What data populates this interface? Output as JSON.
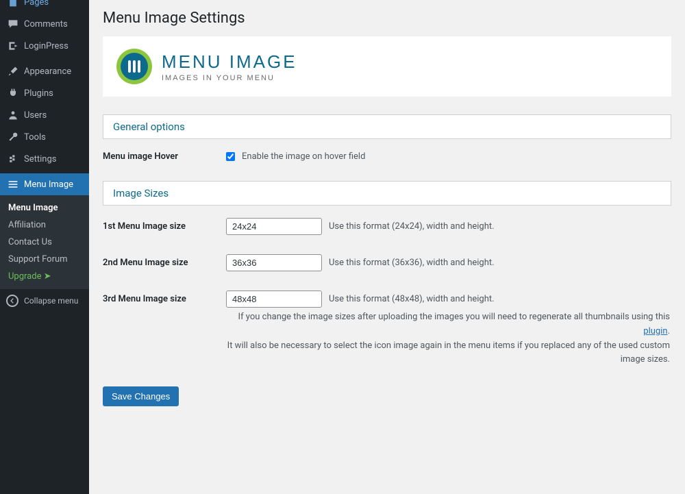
{
  "sidebar": {
    "items": [
      {
        "id": "pages",
        "label": "Pages",
        "icon": "page-icon"
      },
      {
        "id": "comments",
        "label": "Comments",
        "icon": "comment-icon"
      },
      {
        "id": "loginpress",
        "label": "LoginPress",
        "icon": "loginpress-icon"
      },
      {
        "id": "appearance",
        "label": "Appearance",
        "icon": "brush-icon"
      },
      {
        "id": "plugins",
        "label": "Plugins",
        "icon": "plug-icon"
      },
      {
        "id": "users",
        "label": "Users",
        "icon": "user-icon"
      },
      {
        "id": "tools",
        "label": "Tools",
        "icon": "wrench-icon"
      },
      {
        "id": "settings",
        "label": "Settings",
        "icon": "settings-icon"
      },
      {
        "id": "menu-image",
        "label": "Menu Image",
        "icon": "menu-icon",
        "current": true
      }
    ],
    "submenu": [
      {
        "label": "Menu Image",
        "current": true
      },
      {
        "label": "Affiliation"
      },
      {
        "label": "Contact Us"
      },
      {
        "label": "Support Forum"
      },
      {
        "label": "Upgrade",
        "upgrade": true
      }
    ],
    "collapse": "Collapse menu"
  },
  "page": {
    "title": "Menu Image Settings",
    "banner_title": "MENU IMAGE",
    "banner_sub": "IMAGES IN YOUR MENU"
  },
  "sections": {
    "general": "General options",
    "sizes": "Image Sizes"
  },
  "form": {
    "hover_label": "Menu image Hover",
    "hover_text": "Enable the image on hover field",
    "hover_checked": true,
    "size1_label": "1st Menu Image size",
    "size1_value": "24x24",
    "size1_hint": "Use this format (24x24), width and height.",
    "size2_label": "2nd Menu Image size",
    "size2_value": "36x36",
    "size2_hint": "Use this format (36x36), width and height.",
    "size3_label": "3rd Menu Image size",
    "size3_value": "48x48",
    "size3_hint": "Use this format (48x48), width and height.",
    "note_1": "If you change the image sizes after uploading the images you will need to regenerate all thumbnails using this ",
    "note_link": "plugin",
    "note_2": ".",
    "note_3": "It will also be necessary to select the icon image again in the menu items if you replaced any of the used custom image sizes.",
    "save": "Save Changes"
  }
}
